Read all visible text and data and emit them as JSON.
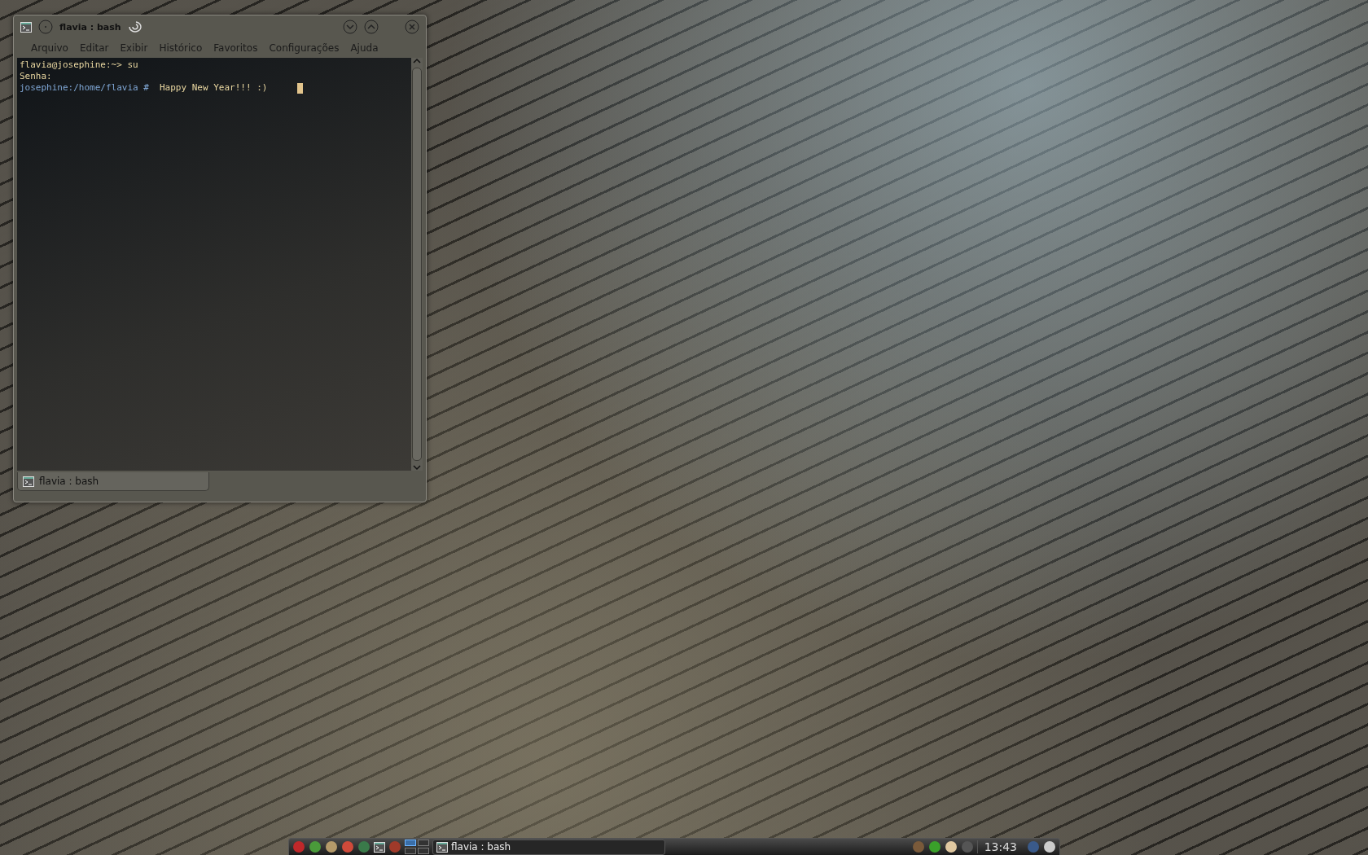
{
  "window": {
    "title": "flavia : bash",
    "menu": [
      "Arquivo",
      "Editar",
      "Exibir",
      "Histórico",
      "Favoritos",
      "Configurações",
      "Ajuda"
    ],
    "lines": [
      [
        {
          "kind": "text",
          "text": "flavia@josephine:~> su"
        }
      ],
      [
        {
          "kind": "text",
          "text": "Senha:"
        }
      ],
      [
        {
          "kind": "root",
          "text": "josephine:/home/flavia #"
        },
        {
          "kind": "text",
          "text": "Happy New Year!!! :)"
        }
      ]
    ],
    "tabs": [
      {
        "label": "flavia : bash",
        "selected": true
      }
    ]
  },
  "taskbar": {
    "pager": [
      {
        "selected": true
      },
      {
        "selected": false
      },
      {
        "selected": false
      },
      {
        "selected": false
      }
    ],
    "tasks": [
      {
        "label": "flavia : bash"
      }
    ],
    "clock": "13:43"
  }
}
